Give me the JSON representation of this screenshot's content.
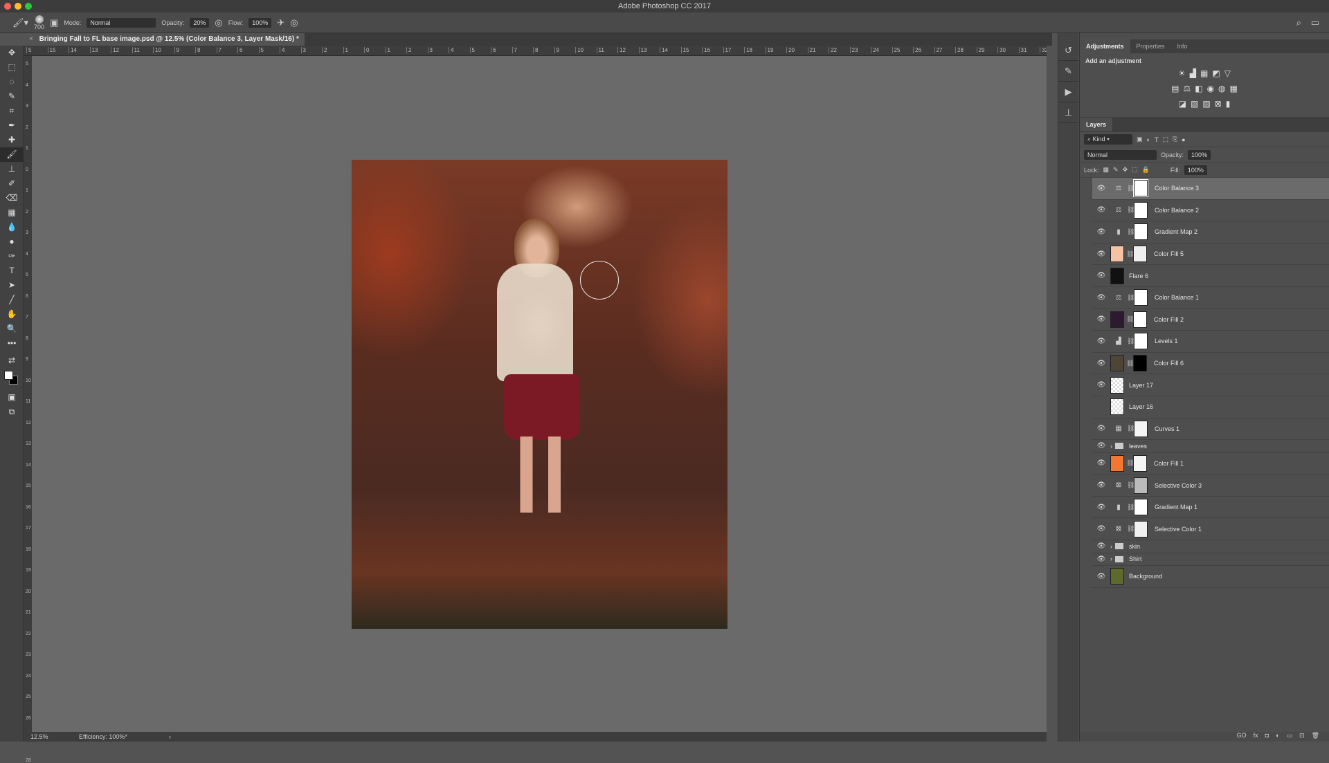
{
  "window": {
    "title": "Adobe Photoshop CC 2017",
    "traffic_colors": [
      "#ff5f57",
      "#febc2e",
      "#28c840"
    ]
  },
  "options": {
    "brush_size": "700",
    "mode_label": "Mode:",
    "mode": "Normal",
    "opacity_label": "Opacity:",
    "opacity": "20%",
    "flow_label": "Flow:",
    "flow": "100%"
  },
  "document": {
    "tab_title": "Bringing Fall to FL base image.psd @ 12.5% (Color Balance 3, Layer Mask/16) *",
    "close": "×"
  },
  "ruler": {
    "top": [
      "5",
      "15",
      "14",
      "13",
      "12",
      "11",
      "10",
      "9",
      "8",
      "7",
      "6",
      "5",
      "4",
      "3",
      "2",
      "1",
      "0",
      "1",
      "2",
      "3",
      "4",
      "5",
      "6",
      "7",
      "8",
      "9",
      "10",
      "11",
      "12",
      "13",
      "14",
      "15",
      "16",
      "17",
      "18",
      "19",
      "20",
      "21",
      "22",
      "23",
      "24",
      "25",
      "26",
      "27",
      "28",
      "29",
      "30",
      "31",
      "32"
    ],
    "left": [
      "5",
      "4",
      "3",
      "2",
      "1",
      "0",
      "1",
      "2",
      "3",
      "4",
      "5",
      "6",
      "7",
      "8",
      "9",
      "10",
      "11",
      "12",
      "13",
      "14",
      "15",
      "16",
      "17",
      "18",
      "19",
      "20",
      "21",
      "22",
      "23",
      "24",
      "25",
      "26",
      "27",
      "28"
    ]
  },
  "status": {
    "zoom": "12.5%",
    "efficiency": "Efficiency: 100%*",
    "arrow": "›"
  },
  "tools": [
    "✥",
    "⬚",
    "◌",
    "✎",
    "⌗",
    "✒",
    "✚",
    "🖌",
    "⊥",
    "✐",
    "⌫",
    "▦",
    "💧",
    "●",
    "✑",
    "T",
    "➤",
    "╱",
    "✋",
    "🔍",
    "•••",
    "⇄",
    "▣",
    "⧉"
  ],
  "panel": {
    "tabs": [
      "Adjustments",
      "Properties",
      "Info"
    ],
    "add_adjustment": "Add an adjustment",
    "adj_icons": [
      [
        "☀",
        "▟",
        "▦",
        "◩",
        "▽"
      ],
      [
        "▤",
        "⚖",
        "◧",
        "◉",
        "◍",
        "▦"
      ],
      [
        "◪",
        "▨",
        "▧",
        "⊠",
        "▮"
      ]
    ],
    "layers_tab": "Layers",
    "kind": "Kind",
    "blend": "Normal",
    "opacity_label": "Opacity:",
    "opacity": "100%",
    "lock_label": "Lock:",
    "fill_label": "Fill:",
    "fill": "100%",
    "layers": [
      {
        "name": "Color Balance 3",
        "kind": "⚖",
        "mask": "#ffffff",
        "visible": true,
        "selected": true
      },
      {
        "name": "Color Balance 2",
        "kind": "⚖",
        "mask": "#ffffff",
        "visible": true
      },
      {
        "name": "Gradient Map 2",
        "kind": "▮",
        "mask": "#ffffff",
        "visible": true
      },
      {
        "name": "Color Fill 5",
        "thumb": "#f5c3a4",
        "mask": "#eeeeee",
        "visible": true
      },
      {
        "name": "Flare 6",
        "thumb": "#111111",
        "visible": true
      },
      {
        "name": "Color Balance 1",
        "kind": "⚖",
        "mask": "#ffffff",
        "visible": true
      },
      {
        "name": "Color Fill 2",
        "thumb": "#2c1a2e",
        "mask": "#ffffff",
        "visible": true
      },
      {
        "name": "Levels 1",
        "kind": "▟",
        "mask": "#ffffff",
        "visible": true
      },
      {
        "name": "Color Fill 6",
        "thumb": "#4e4536",
        "mask": "#000000",
        "visible": true
      },
      {
        "name": "Layer 17",
        "thumb": "checker",
        "visible": true
      },
      {
        "name": "Layer 16",
        "thumb": "checker",
        "visible": false
      },
      {
        "name": "Curves 1",
        "kind": "▦",
        "mask": "#f4f4f4",
        "visible": true
      },
      {
        "name": "leaves",
        "group": true,
        "visible": true
      },
      {
        "name": "Color Fill 1",
        "thumb": "#f47630",
        "mask": "#f4f4f4",
        "visible": true
      },
      {
        "name": "Selective Color 3",
        "kind": "⊠",
        "mask": "#bbbbbb",
        "visible": true
      },
      {
        "name": "Gradient Map 1",
        "kind": "▮",
        "mask": "#ffffff",
        "visible": true
      },
      {
        "name": "Selective Color 1",
        "kind": "⊠",
        "mask": "#f0f0f0",
        "visible": true
      },
      {
        "name": "skin",
        "group": true,
        "visible": true
      },
      {
        "name": "Shirt",
        "group": true,
        "visible": true
      },
      {
        "name": "Background",
        "thumb": "#5d6a2c",
        "visible": true
      }
    ],
    "footer_icons": [
      "GO",
      "fx",
      "◘",
      "◐",
      "▭",
      "⊡",
      "🗑"
    ]
  }
}
